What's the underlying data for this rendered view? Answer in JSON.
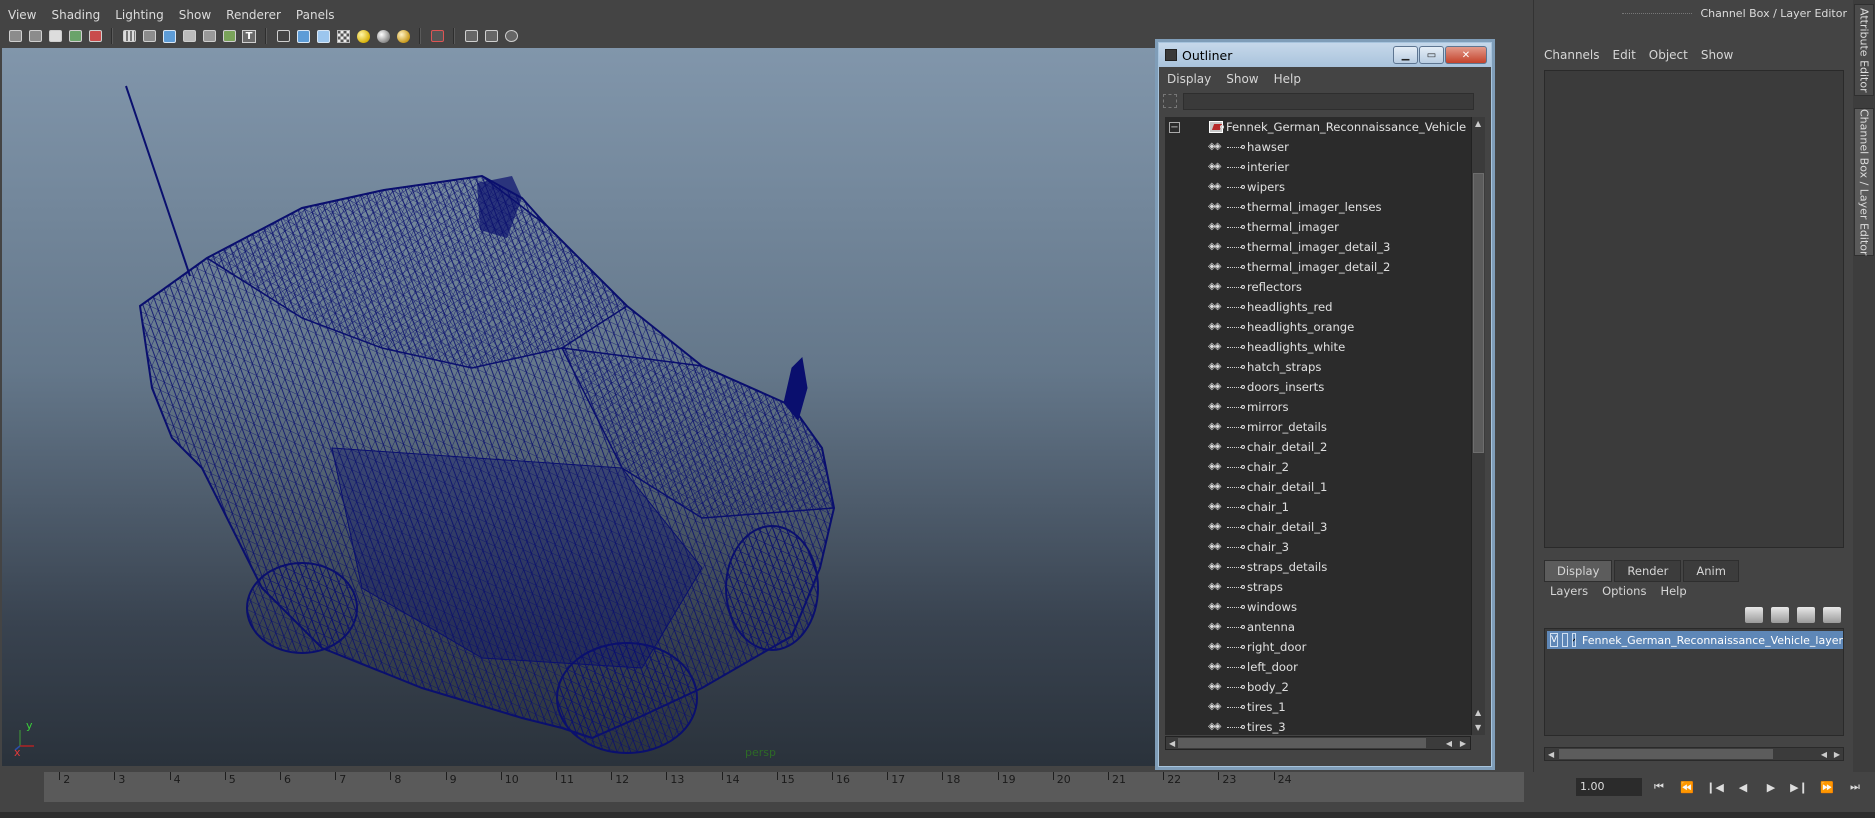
{
  "panel_menu": [
    "View",
    "Shading",
    "Lighting",
    "Show",
    "Renderer",
    "Panels"
  ],
  "toolbar_icons": [
    "camera-icon",
    "camera-attributes-icon",
    "bookmark-icon",
    "image-plane-icon",
    "2d-pan-icon",
    "grid-icon",
    "film-gate-icon",
    "resolution-gate-icon",
    "gate-mask-icon",
    "field-chart-icon",
    "safe-action-icon",
    "safe-title-icon",
    "wireframe-icon",
    "smooth-shade-icon",
    "wireframe-on-shaded-icon",
    "textured-icon",
    "use-all-lights-icon",
    "shadows-icon",
    "isolate-select-icon",
    "xray-icon",
    "xray-joints-icon",
    "backface-culling-icon"
  ],
  "viewport": {
    "camera_label": "persp",
    "axis_x": "x",
    "axis_y": "y"
  },
  "outliner": {
    "title": "Outliner",
    "menu": [
      "Display",
      "Show",
      "Help"
    ],
    "filter_value": "",
    "root": "Fennek_German_Reconnaissance_Vehicle",
    "children": [
      "hawser",
      "interier",
      "wipers",
      "thermal_imager_lenses",
      "thermal_imager",
      "thermal_imager_detail_3",
      "thermal_imager_detail_2",
      "reflectors",
      "headlights_red",
      "headlights_orange",
      "headlights_white",
      "hatch_straps",
      "doors_inserts",
      "mirrors",
      "mirror_details",
      "chair_detail_2",
      "chair_2",
      "chair_detail_1",
      "chair_1",
      "chair_detail_3",
      "chair_3",
      "straps_details",
      "straps",
      "windows",
      "antenna",
      "right_door",
      "left_door",
      "body_2",
      "tires_1",
      "tires_3"
    ]
  },
  "right_panel": {
    "header": "Channel Box / Layer Editor",
    "channel_menu": [
      "Channels",
      "Edit",
      "Object",
      "Show"
    ],
    "layer_tabs": [
      "Display",
      "Render",
      "Anim"
    ],
    "active_layer_tab": "Display",
    "layer_menu": [
      "Layers",
      "Options",
      "Help"
    ],
    "layer": {
      "visibility": "V",
      "name": "Fennek_German_Reconnaissance_Vehicle_layer"
    }
  },
  "side_tabs": [
    "Attribute Editor",
    "Channel Box / Layer Editor"
  ],
  "timeline": {
    "frames": [
      "2",
      "3",
      "4",
      "5",
      "6",
      "7",
      "8",
      "9",
      "10",
      "11",
      "12",
      "13",
      "14",
      "15",
      "16",
      "17",
      "18",
      "19",
      "20",
      "21",
      "22",
      "23",
      "24"
    ],
    "current_frame": "1.00",
    "playback_buttons": [
      "go-to-start-icon",
      "step-back-key-icon",
      "step-back-frame-icon",
      "play-backwards-icon",
      "play-forwards-icon",
      "step-forward-frame-icon",
      "step-forward-key-icon",
      "go-to-end-icon"
    ]
  },
  "colors": {
    "wireframe": "#0a0f6e",
    "viewport_top": "#8196ab",
    "viewport_bottom": "#2a323b",
    "layer_selected": "#5e87b7",
    "outliner_frame": "#a9c3dc"
  }
}
